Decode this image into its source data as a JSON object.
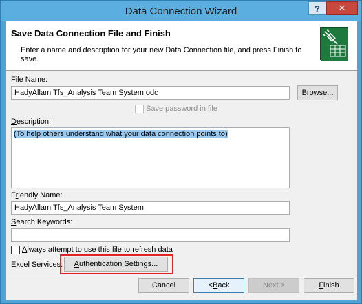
{
  "window": {
    "title": "Data Connection Wizard"
  },
  "titlebar": {
    "help_label": "?",
    "close_label": "✕"
  },
  "header": {
    "title": "Save Data Connection File and Finish",
    "description": "Enter a name and description for your new Data Connection file, and press Finish to save."
  },
  "form": {
    "file_name_label_pre": "File ",
    "file_name_label_ul": "N",
    "file_name_label_post": "ame:",
    "file_name_value": "HadyAllam Tfs_Analysis Team System.odc",
    "browse_pre": "B",
    "browse_post": "rowse...",
    "save_password_label": "Save password in file",
    "description_label_ul": "D",
    "description_label_post": "escription:",
    "description_value": "(To help others understand what your data connection points to)",
    "friendly_label_pre": "F",
    "friendly_label_ul": "r",
    "friendly_label_post": "iendly Name:",
    "friendly_value": "HadyAllam Tfs_Analysis Team System",
    "keywords_label_ul": "S",
    "keywords_label_post": "earch Keywords:",
    "keywords_value": "",
    "always_attempt_ul": "A",
    "always_attempt_post": "lways attempt to use this file to refresh data",
    "excel_services_label": "Excel Services:",
    "auth_settings_ul": "A",
    "auth_settings_post": "uthentication Settings..."
  },
  "footer": {
    "cancel": "Cancel",
    "back_pre": "< ",
    "back_ul": "B",
    "back_post": "ack",
    "next": "Next >",
    "finish_ul": "F",
    "finish_post": "inish"
  },
  "colors": {
    "titlebar": "#5aaee0",
    "close": "#c7483d",
    "highlight": "#e32222",
    "selection": "#99c9ef"
  }
}
